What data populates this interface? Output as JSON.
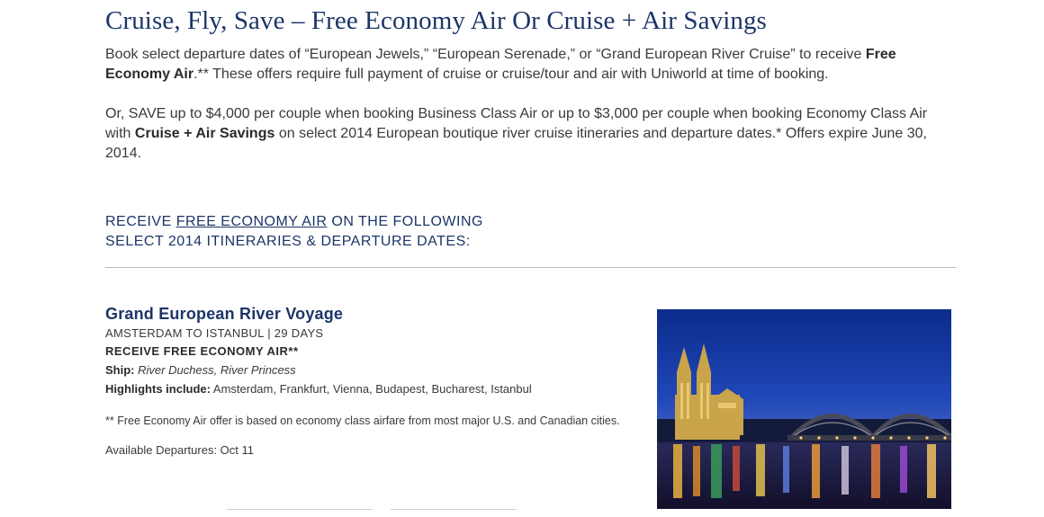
{
  "title": "Cruise, Fly, Save – Free Economy Air Or Cruise + Air Savings",
  "intro": {
    "p1_a": "Book select departure dates of “European Jewels,” “European Serenade,” or “Grand European River Cruise” to receive ",
    "p1_bold": "Free Economy Air",
    "p1_b": ".** These offers require full payment of cruise or cruise/tour and air with Uniworld at time of booking.",
    "p2_a": "Or, SAVE up to $4,000 per couple when booking Business Class Air or up to $3,000 per couple when booking Economy Class Air with ",
    "p2_bold": "Cruise + Air Savings",
    "p2_b": " on select 2014 European boutique river cruise itineraries and departure dates.* Offers expire June 30, 2014."
  },
  "receive_heading": {
    "prefix": "RECEIVE ",
    "link": "FREE ECONOMY AIR",
    "suffix": " ON THE FOLLOWING",
    "line2": "SELECT 2014 ITINERARIES & DEPARTURE DATES:"
  },
  "voyage": {
    "name": "Grand European River Voyage",
    "route": "AMSTERDAM TO ISTANBUL | 29 DAYS",
    "offer": "RECEIVE FREE ECONOMY AIR**",
    "ship_label": "Ship:",
    "ship_value": "River Duchess, River Princess",
    "highlights_label": "Highlights include:",
    "highlights_value": "Amsterdam, Frankfurt, Vienna, Budapest, Bucharest, Istanbul",
    "note": "** Free Economy Air offer is based on economy class airfare from most major U.S. and Canadian cities.",
    "departures": "Available Departures: Oct 11"
  },
  "photo": {
    "icon": "cologne-cathedral-bridge-night-photo"
  },
  "colors": {
    "heading": "#1c3567",
    "body_text": "#3a3a3a",
    "divider": "#b9b9b9"
  }
}
